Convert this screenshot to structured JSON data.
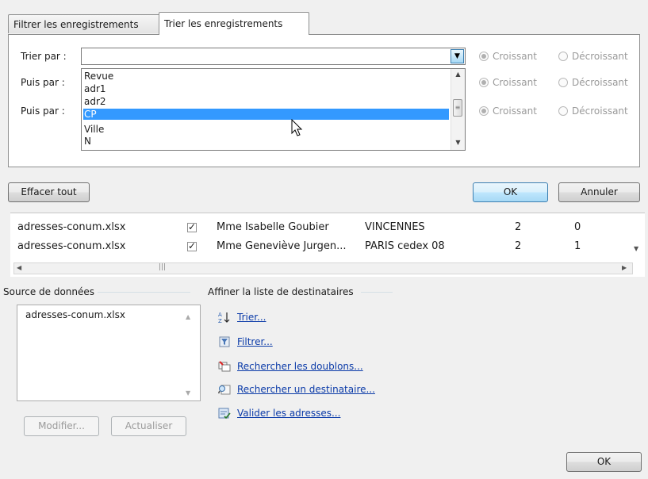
{
  "tabs": {
    "filter": "Filtrer les enregistrements",
    "sort": "Trier les enregistrements"
  },
  "sort_rows": [
    {
      "label": "Trier par :",
      "value": ""
    },
    {
      "label": "Puis par :",
      "value": ""
    },
    {
      "label": "Puis par :",
      "value": ""
    }
  ],
  "dropdown_items": [
    "Revue",
    "adr1",
    "adr2",
    "CP",
    "Ville",
    "N"
  ],
  "dropdown_selected": "CP",
  "order": {
    "asc": "Croissant",
    "desc": "Décroissant"
  },
  "dialog_buttons": {
    "clear": "Effacer tout",
    "ok": "OK",
    "cancel": "Annuler"
  },
  "recipients": [
    {
      "source": "adresses-conum.xlsx",
      "checked": true,
      "name": "Mme Isabelle Goubier",
      "city": "VINCENNES",
      "n1": "2",
      "n2": "0"
    },
    {
      "source": "adresses-conum.xlsx",
      "checked": true,
      "name": "Mme Geneviève Jurgen...",
      "city": "PARIS cedex 08",
      "n1": "2",
      "n2": "1"
    }
  ],
  "datasource": {
    "title": "Source de données",
    "items": [
      "adresses-conum.xlsx"
    ],
    "modify": "Modifier...",
    "refresh": "Actualiser"
  },
  "refine": {
    "title": "Affiner la liste de destinataires",
    "links": [
      {
        "label": "Trier...",
        "icon": "sort-az-icon"
      },
      {
        "label": "Filtrer...",
        "icon": "filter-icon"
      },
      {
        "label": "Rechercher les doublons...",
        "icon": "duplicates-icon"
      },
      {
        "label": "Rechercher un destinataire...",
        "icon": "find-recipient-icon"
      },
      {
        "label": "Valider les adresses...",
        "icon": "validate-addresses-icon"
      }
    ]
  },
  "bottom_ok": "OK",
  "colors": {
    "selection": "#3399ff",
    "link": "#0a3aa8"
  }
}
